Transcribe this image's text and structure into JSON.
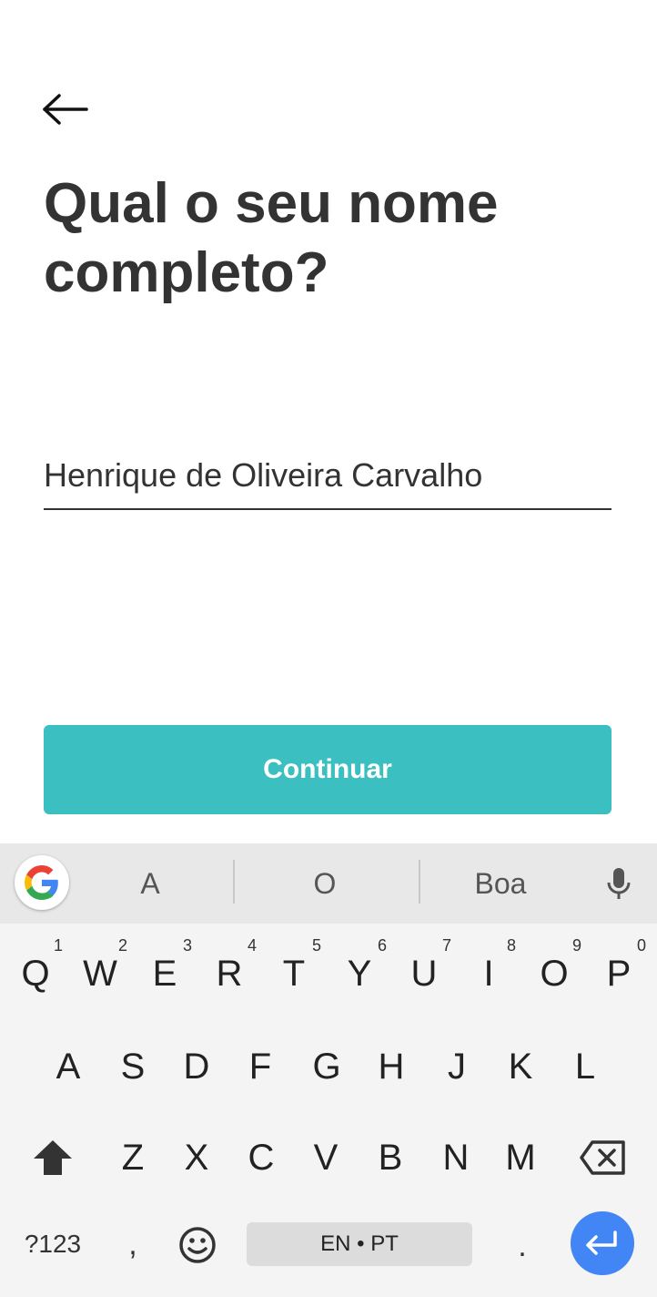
{
  "header": {
    "back_icon": "arrow-left-icon",
    "title": "Qual o seu nome completo?"
  },
  "form": {
    "name_value": "Henrique de Oliveira Carvalho"
  },
  "actions": {
    "continue_label": "Continuar",
    "continue_color": "#3bbfc0"
  },
  "keyboard": {
    "suggestions": [
      "A",
      "O",
      "Boa"
    ],
    "row1": [
      {
        "label": "Q",
        "hint": "1"
      },
      {
        "label": "W",
        "hint": "2"
      },
      {
        "label": "E",
        "hint": "3"
      },
      {
        "label": "R",
        "hint": "4"
      },
      {
        "label": "T",
        "hint": "5"
      },
      {
        "label": "Y",
        "hint": "6"
      },
      {
        "label": "U",
        "hint": "7"
      },
      {
        "label": "I",
        "hint": "8"
      },
      {
        "label": "O",
        "hint": "9"
      },
      {
        "label": "P",
        "hint": "0"
      }
    ],
    "row2": [
      "A",
      "S",
      "D",
      "F",
      "G",
      "H",
      "J",
      "K",
      "L"
    ],
    "row3": [
      "Z",
      "X",
      "C",
      "V",
      "B",
      "N",
      "M"
    ],
    "symbols_label": "?123",
    "comma_label": ",",
    "space_label": "EN • PT",
    "period_label": ".",
    "enter_color": "#4285f4"
  }
}
